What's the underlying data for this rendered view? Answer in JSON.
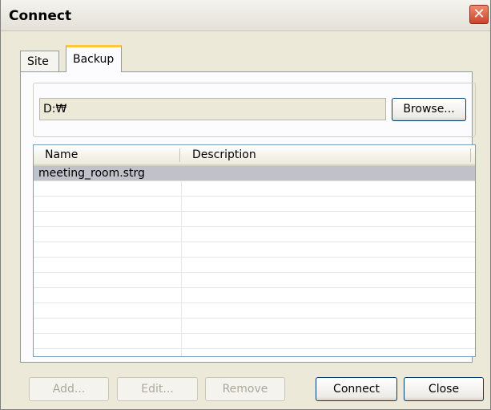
{
  "window": {
    "title": "Connect",
    "close_glyph": "✕"
  },
  "tabs": [
    {
      "label": "Site",
      "active": false
    },
    {
      "label": "Backup",
      "active": true
    }
  ],
  "backup": {
    "path": "D:₩",
    "browse_label": "Browse..."
  },
  "list": {
    "columns": [
      "Name",
      "Description"
    ],
    "rows": [
      {
        "name": "meeting_room.strg",
        "description": "",
        "selected": true
      },
      {
        "name": "",
        "description": ""
      },
      {
        "name": "",
        "description": ""
      },
      {
        "name": "",
        "description": ""
      },
      {
        "name": "",
        "description": ""
      },
      {
        "name": "",
        "description": ""
      },
      {
        "name": "",
        "description": ""
      },
      {
        "name": "",
        "description": ""
      },
      {
        "name": "",
        "description": ""
      },
      {
        "name": "",
        "description": ""
      },
      {
        "name": "",
        "description": ""
      },
      {
        "name": "",
        "description": ""
      }
    ]
  },
  "footer": {
    "add_label": "Add...",
    "edit_label": "Edit...",
    "remove_label": "Remove",
    "connect_label": "Connect",
    "close_label": "Close"
  },
  "colors": {
    "dialog_bg": "#ece9d8",
    "active_tab_accent": "#ffc83c",
    "close_button_red": "#d9573b",
    "selection_bg": "#c1c1c9"
  }
}
